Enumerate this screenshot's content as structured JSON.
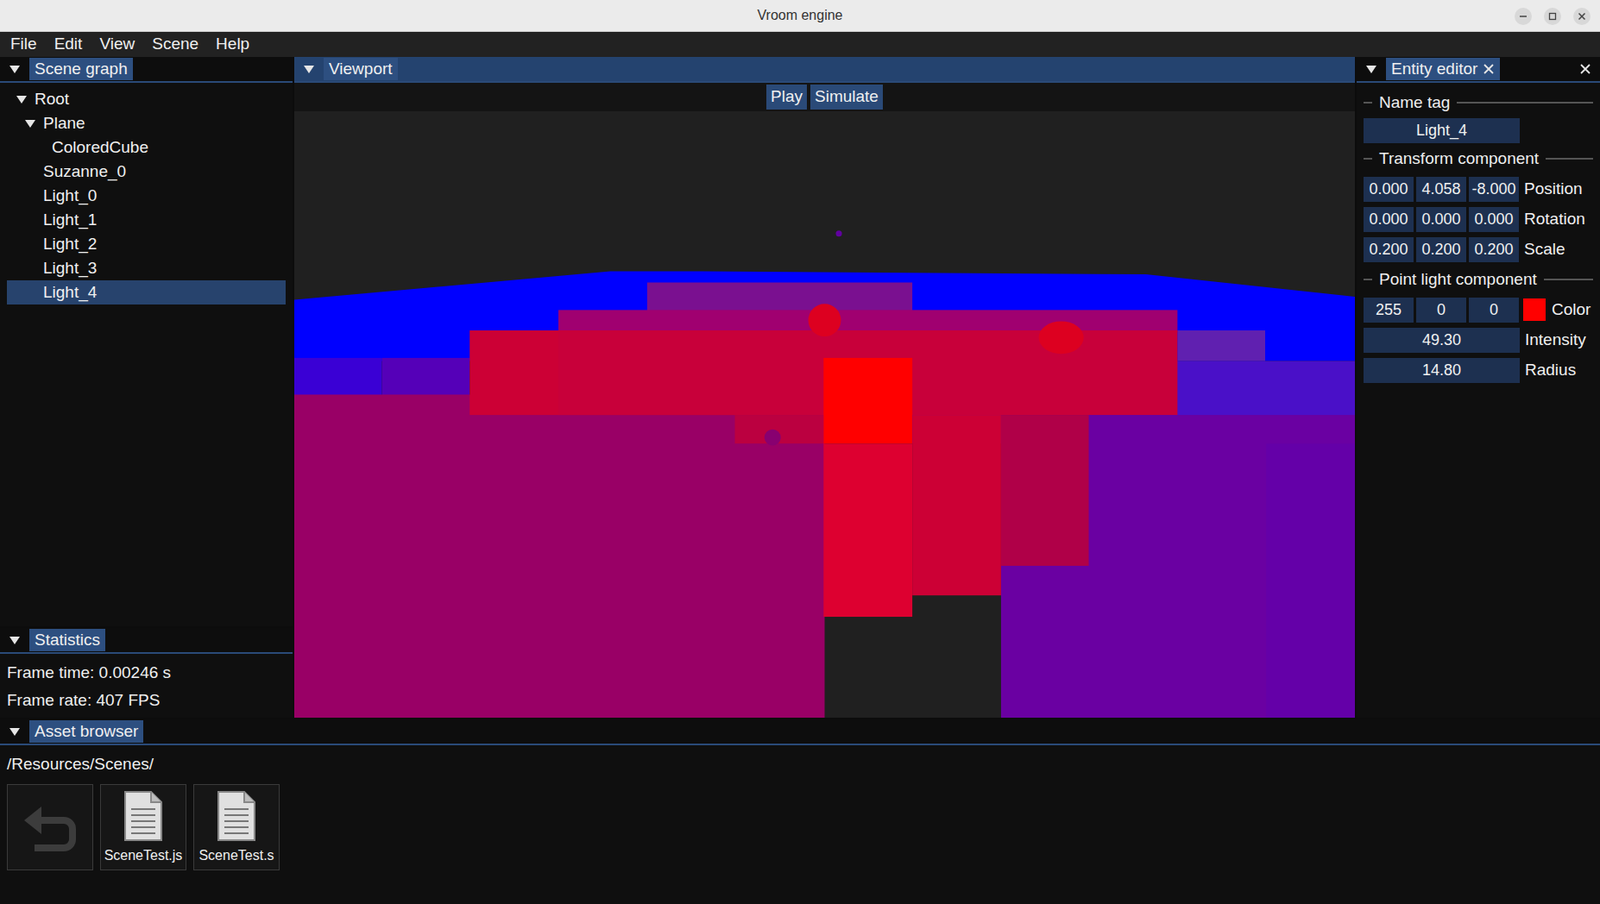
{
  "window": {
    "title": "Vroom engine"
  },
  "menu": [
    "File",
    "Edit",
    "View",
    "Scene",
    "Help"
  ],
  "scene_graph": {
    "title": "Scene graph",
    "items": [
      {
        "label": "Root",
        "depth": 0,
        "expandable": true,
        "expanded": true,
        "selected": false
      },
      {
        "label": "Plane",
        "depth": 1,
        "expandable": true,
        "expanded": true,
        "selected": false
      },
      {
        "label": "ColoredCube",
        "depth": 2,
        "expandable": false,
        "expanded": false,
        "selected": false
      },
      {
        "label": "Suzanne_0",
        "depth": 1,
        "expandable": false,
        "expanded": false,
        "selected": false
      },
      {
        "label": "Light_0",
        "depth": 1,
        "expandable": false,
        "expanded": false,
        "selected": false
      },
      {
        "label": "Light_1",
        "depth": 1,
        "expandable": false,
        "expanded": false,
        "selected": false
      },
      {
        "label": "Light_2",
        "depth": 1,
        "expandable": false,
        "expanded": false,
        "selected": false
      },
      {
        "label": "Light_3",
        "depth": 1,
        "expandable": false,
        "expanded": false,
        "selected": false
      },
      {
        "label": "Light_4",
        "depth": 1,
        "expandable": false,
        "expanded": false,
        "selected": true
      }
    ]
  },
  "viewport": {
    "title": "Viewport",
    "buttons": [
      "Play",
      "Simulate"
    ]
  },
  "entity_editor": {
    "title": "Entity editor",
    "name_tag": {
      "label": "Name tag",
      "value": "Light_4"
    },
    "transform": {
      "label": "Transform component",
      "rows": [
        {
          "label": "Position",
          "values": [
            "0.000",
            "4.058",
            "-8.000"
          ]
        },
        {
          "label": "Rotation",
          "values": [
            "0.000",
            "0.000",
            "0.000"
          ]
        },
        {
          "label": "Scale",
          "values": [
            "0.200",
            "0.200",
            "0.200"
          ]
        }
      ]
    },
    "point_light": {
      "label": "Point light component",
      "color": {
        "label": "Color",
        "values": [
          "255",
          "0",
          "0"
        ],
        "color": "#ff0000"
      },
      "fields": [
        {
          "label": "Intensity",
          "value": "49.30"
        },
        {
          "label": "Radius",
          "value": "14.80"
        }
      ]
    }
  },
  "statistics": {
    "title": "Statistics",
    "lines": [
      "Frame time: 0.00246 s",
      "Frame rate: 407 FPS"
    ]
  },
  "asset_browser": {
    "title": "Asset browser",
    "path": "/Resources/Scenes/",
    "files": [
      "SceneTest.js",
      "SceneTest.s"
    ]
  }
}
